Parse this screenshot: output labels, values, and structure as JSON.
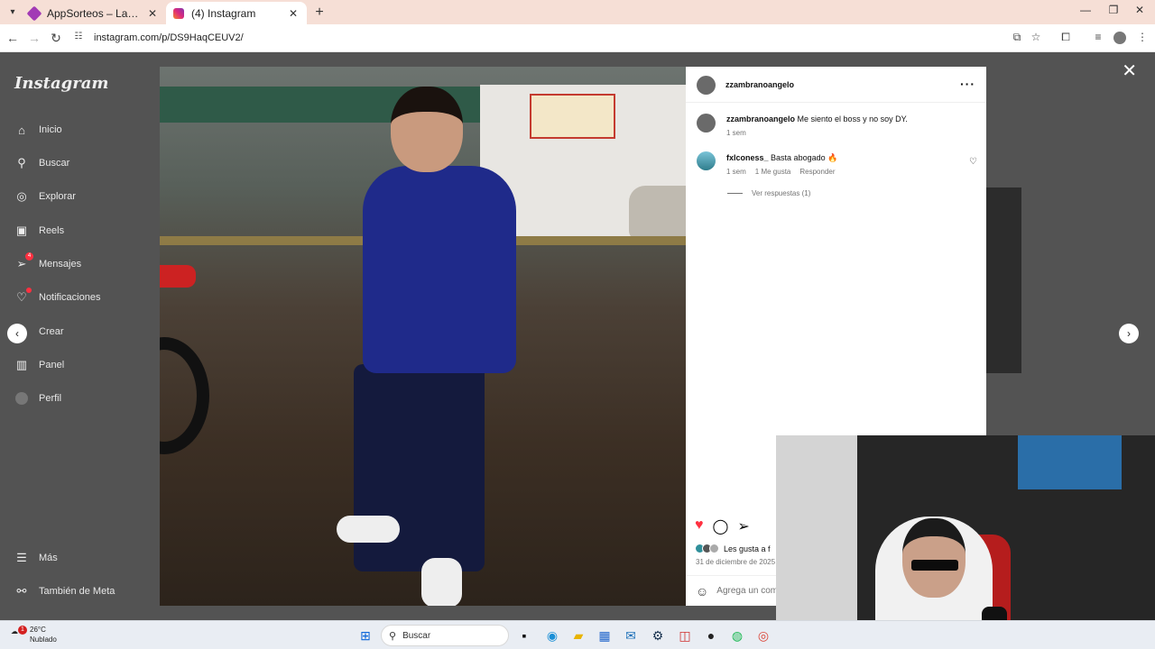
{
  "browser": {
    "tabs": [
      {
        "title": "AppSorteos – La Ruleta de la Suerte",
        "favicon_color": "#a23ab5"
      },
      {
        "title": "(4) Instagram",
        "favicon_color": "#e1306c"
      }
    ],
    "url": "instagram.com/p/DS9HaqCEUV2/"
  },
  "sidebar": {
    "logo": "Instagram",
    "items": [
      {
        "label": "Inicio",
        "icon": "home-icon"
      },
      {
        "label": "Buscar",
        "icon": "search-icon"
      },
      {
        "label": "Explorar",
        "icon": "compass-icon"
      },
      {
        "label": "Reels",
        "icon": "reels-icon"
      },
      {
        "label": "Mensajes",
        "icon": "messenger-icon",
        "badge": "4"
      },
      {
        "label": "Notificaciones",
        "icon": "heart-icon"
      },
      {
        "label": "Crear",
        "icon": "plus-icon"
      },
      {
        "label": "Panel",
        "icon": "dashboard-icon"
      },
      {
        "label": "Perfil",
        "icon": "profile-icon"
      }
    ],
    "bottom_items": [
      {
        "label": "Más",
        "icon": "menu-icon"
      },
      {
        "label": "También de Meta",
        "icon": "meta-icon"
      }
    ]
  },
  "post": {
    "username": "zzambranoangelo",
    "caption_user": "zzambranoangelo",
    "caption": "Me siento el boss y no soy DY.",
    "caption_time": "1 sem",
    "comment": {
      "user": "fxlconess_",
      "text": "Basta abogado 🔥",
      "time": "1 sem",
      "likes": "1 Me gusta",
      "reply": "Responder"
    },
    "view_replies": "Ver respuestas (1)",
    "likes_text": "Les gusta a f",
    "date": "31 de diciembre de 2025",
    "add_comment_placeholder": "Agrega un com"
  },
  "taskbar": {
    "temperature": "26°C",
    "weather": "Nublado",
    "weather_badge": "1",
    "search_label": "Buscar"
  }
}
